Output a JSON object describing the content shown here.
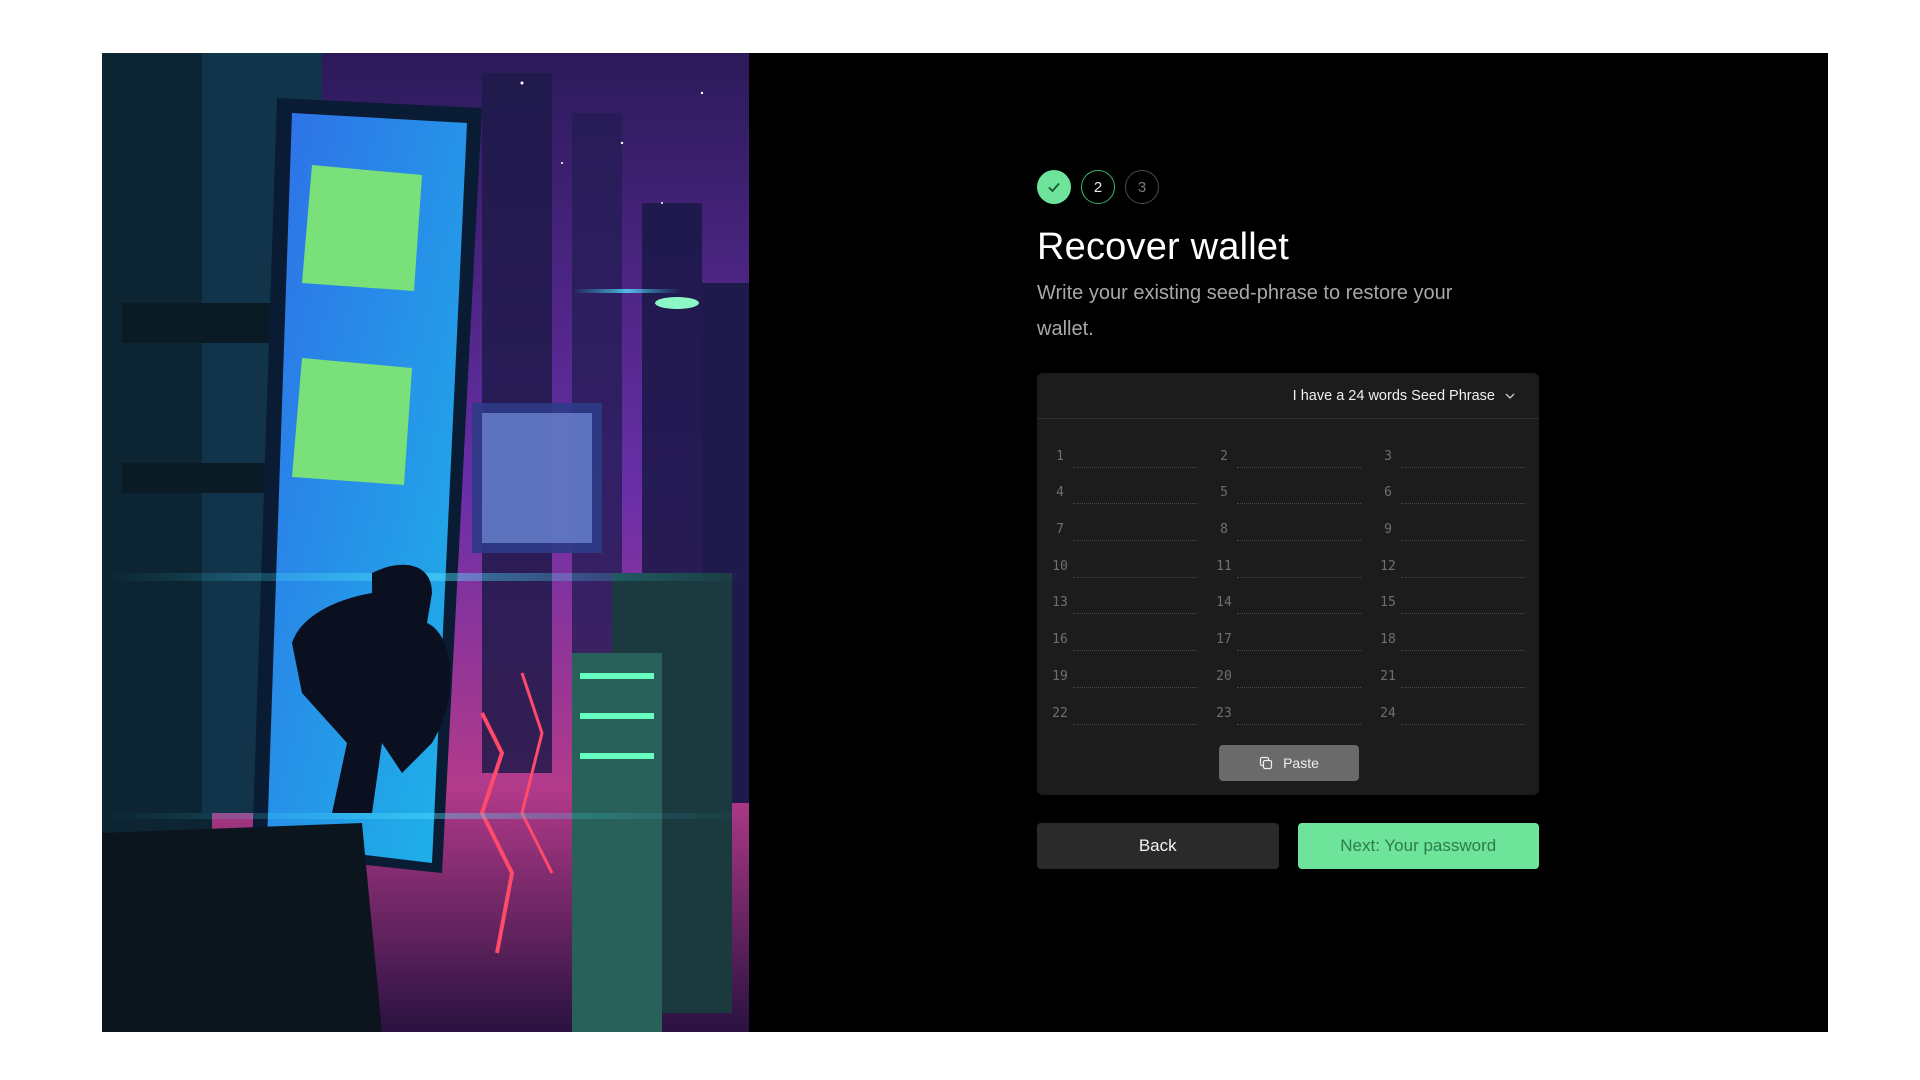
{
  "steps": [
    {
      "label": "",
      "state": "done",
      "icon": "check-icon"
    },
    {
      "label": "2",
      "state": "current"
    },
    {
      "label": "3",
      "state": "todo"
    }
  ],
  "title": "Recover wallet",
  "subtitle": "Write your existing seed-phrase to restore your wallet.",
  "seed": {
    "selector_label": "I have a 24 words Seed Phrase",
    "selector_icon": "chevron-down-icon",
    "words": [
      {
        "n": "1",
        "value": ""
      },
      {
        "n": "2",
        "value": ""
      },
      {
        "n": "3",
        "value": ""
      },
      {
        "n": "4",
        "value": ""
      },
      {
        "n": "5",
        "value": ""
      },
      {
        "n": "6",
        "value": ""
      },
      {
        "n": "7",
        "value": ""
      },
      {
        "n": "8",
        "value": ""
      },
      {
        "n": "9",
        "value": ""
      },
      {
        "n": "10",
        "value": ""
      },
      {
        "n": "11",
        "value": ""
      },
      {
        "n": "12",
        "value": ""
      },
      {
        "n": "13",
        "value": ""
      },
      {
        "n": "14",
        "value": ""
      },
      {
        "n": "15",
        "value": ""
      },
      {
        "n": "16",
        "value": ""
      },
      {
        "n": "17",
        "value": ""
      },
      {
        "n": "18",
        "value": ""
      },
      {
        "n": "19",
        "value": ""
      },
      {
        "n": "20",
        "value": ""
      },
      {
        "n": "21",
        "value": ""
      },
      {
        "n": "22",
        "value": ""
      },
      {
        "n": "23",
        "value": ""
      },
      {
        "n": "24",
        "value": ""
      }
    ],
    "paste_label": "Paste",
    "paste_icon": "copy-icon"
  },
  "buttons": {
    "back": "Back",
    "next": "Next: Your password"
  },
  "colors": {
    "accent": "#6ee49a",
    "background": "#000000",
    "panel": "#1c1c1c"
  }
}
